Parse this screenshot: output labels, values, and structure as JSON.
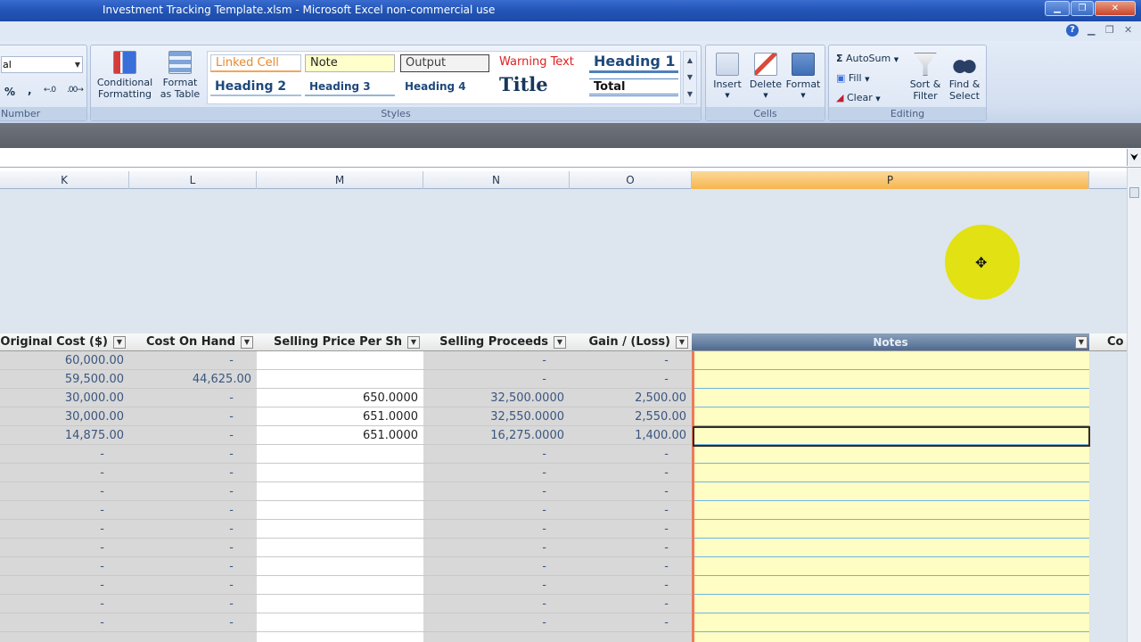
{
  "window": {
    "title": "Investment Tracking Template.xlsm - Microsoft Excel non-commercial use"
  },
  "ribbon": {
    "number_group": {
      "label": "Number",
      "format_value": "al",
      "percent": "%",
      "comma": ","
    },
    "styles_group": {
      "label": "Styles",
      "conditional_formatting": "Conditional\nFormatting",
      "format_as_table": "Format\nas Table",
      "cells": [
        "Linked Cell",
        "Note",
        "Output",
        "Warning Text",
        "Heading 1",
        "Heading 2",
        "Heading 3",
        "Heading 4",
        "Title",
        "Total"
      ]
    },
    "cells_group": {
      "label": "Cells",
      "insert": "Insert",
      "delete": "Delete",
      "format": "Format"
    },
    "editing_group": {
      "label": "Editing",
      "autosum": "AutoSum",
      "fill": "Fill",
      "clear": "Clear",
      "sort_filter": "Sort &\nFilter",
      "find_select": "Find &\nSelect"
    }
  },
  "columns": [
    "K",
    "L",
    "M",
    "N",
    "O",
    "P"
  ],
  "table": {
    "headers": [
      "Original Cost ($)",
      "Cost On Hand",
      "Selling Price Per Sh",
      "Selling Proceeds",
      "Gain / (Loss)",
      "Notes",
      "Co"
    ],
    "rows": [
      [
        "60,000.00",
        "-",
        "",
        "-",
        "-"
      ],
      [
        "59,500.00",
        "44,625.00",
        "",
        "-",
        "-"
      ],
      [
        "30,000.00",
        "-",
        "650.0000",
        "32,500.0000",
        "2,500.00"
      ],
      [
        "30,000.00",
        "-",
        "651.0000",
        "32,550.0000",
        "2,550.00"
      ],
      [
        "14,875.00",
        "-",
        "651.0000",
        "16,275.0000",
        "1,400.00"
      ],
      [
        "-",
        "-",
        "",
        "-",
        "-"
      ],
      [
        "-",
        "-",
        "",
        "-",
        "-"
      ],
      [
        "-",
        "-",
        "",
        "-",
        "-"
      ],
      [
        "-",
        "-",
        "",
        "-",
        "-"
      ],
      [
        "-",
        "-",
        "",
        "-",
        "-"
      ],
      [
        "-",
        "-",
        "",
        "-",
        "-"
      ],
      [
        "-",
        "-",
        "",
        "-",
        "-"
      ],
      [
        "-",
        "-",
        "",
        "-",
        "-"
      ],
      [
        "-",
        "-",
        "",
        "-",
        "-"
      ],
      [
        "-",
        "-",
        "",
        "-",
        "-"
      ]
    ]
  },
  "colors": {
    "selected_column": "#f6b64e",
    "notes_fill": "#fefdc3",
    "notes_header": "#5a7599",
    "cursor_highlight": "#e1e100"
  }
}
